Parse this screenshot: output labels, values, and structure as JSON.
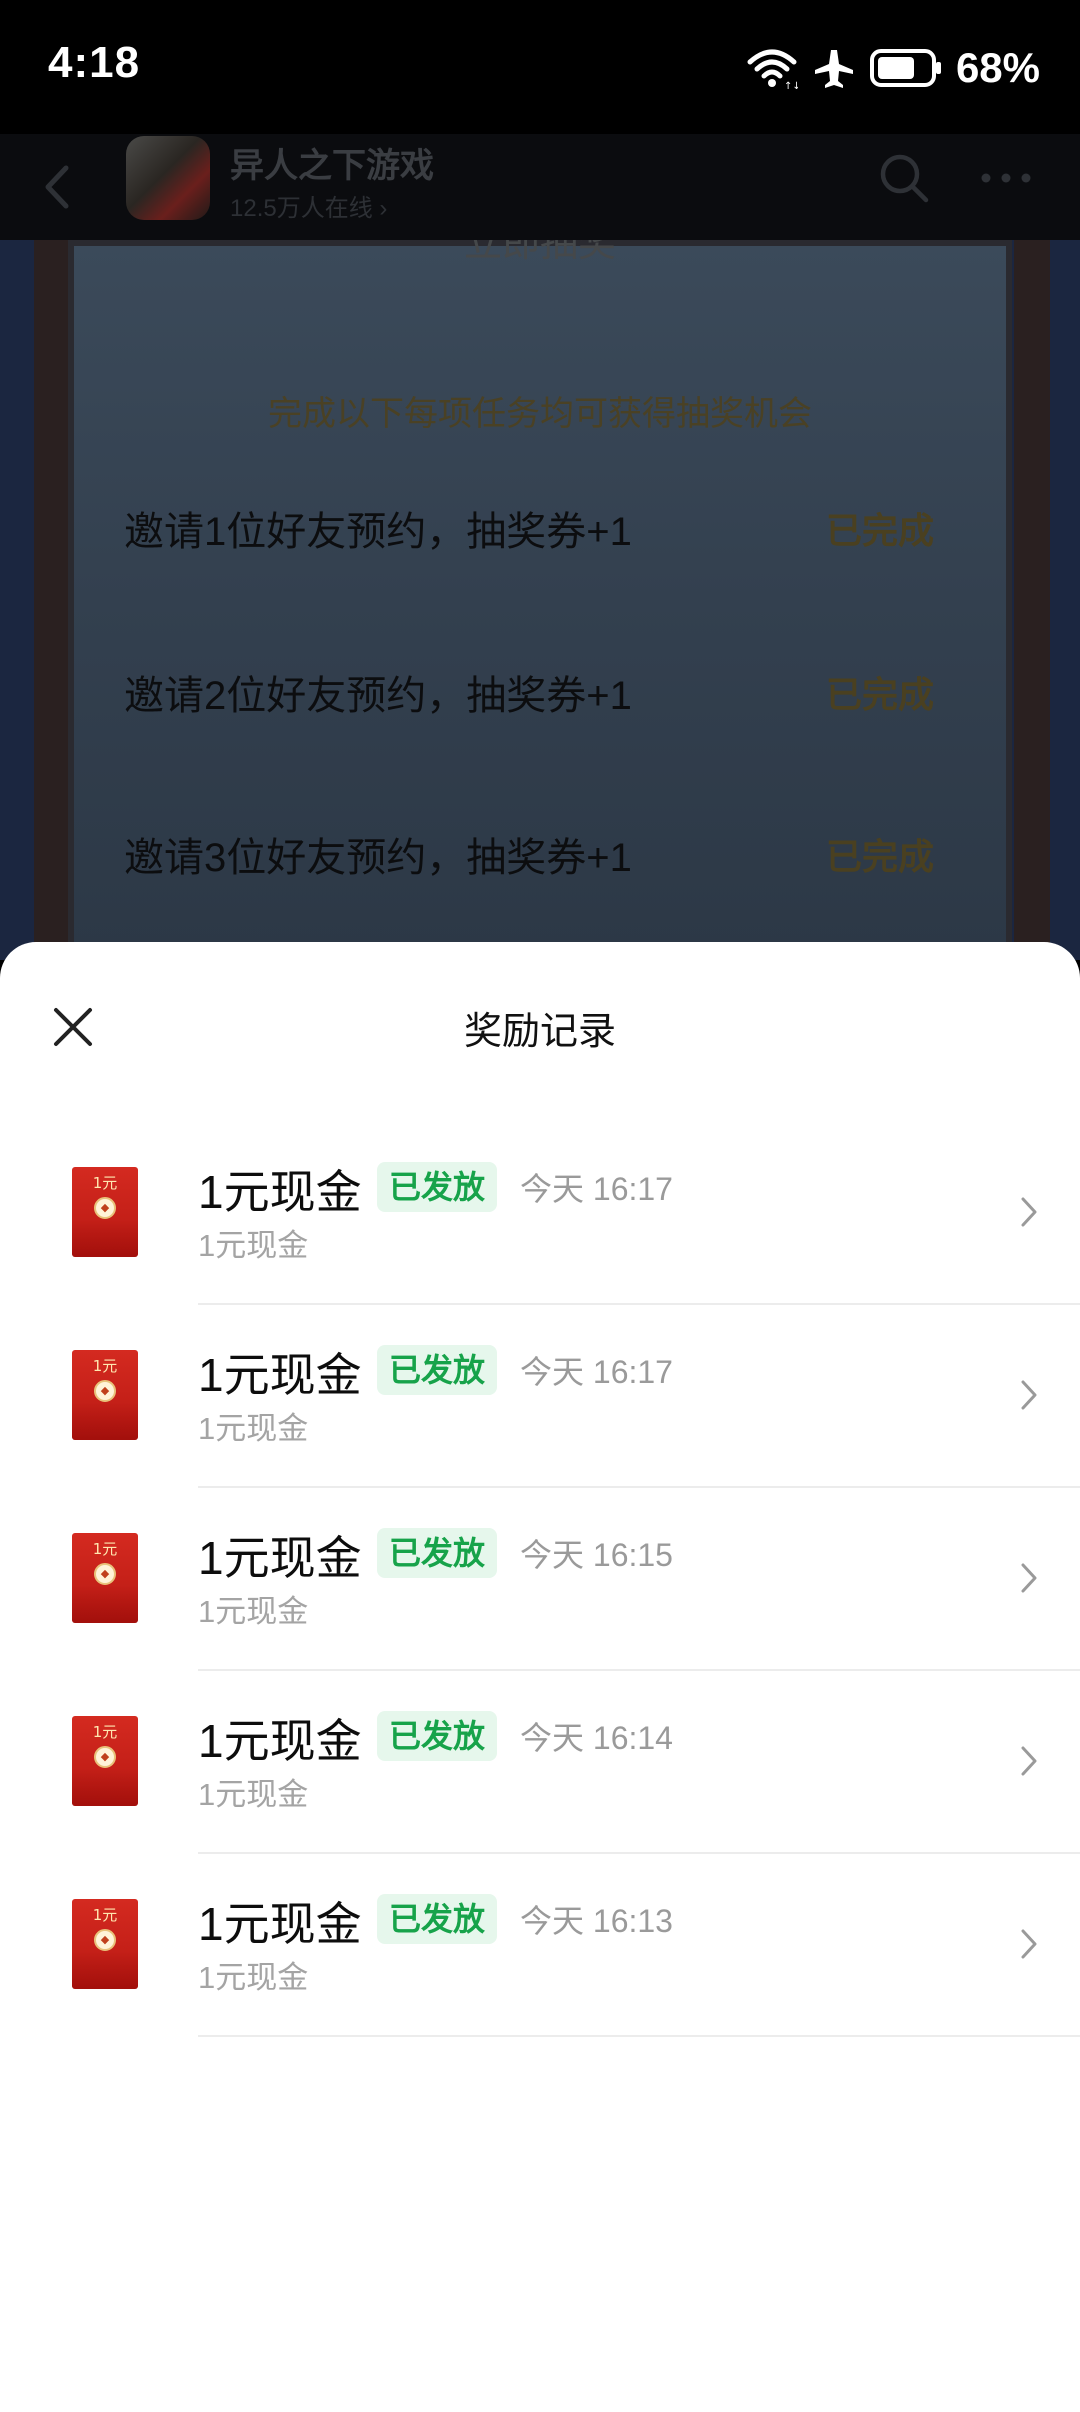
{
  "status_bar": {
    "time": "4:18",
    "battery_percent": "68%",
    "icons": [
      "wifi-icon",
      "airplane-icon",
      "battery-icon"
    ]
  },
  "header": {
    "title": "异人之下游戏",
    "online": "12.5万人在线"
  },
  "background_page": {
    "draw_title": "立即抽奖",
    "task_hint": "完成以下每项任务均可获得抽奖机会",
    "tasks": [
      {
        "label": "邀请1位好友预约，抽奖券+1",
        "status": "已完成"
      },
      {
        "label": "邀请2位好友预约，抽奖券+1",
        "status": "已完成"
      },
      {
        "label": "邀请3位好友预约，抽奖券+1",
        "status": "已完成"
      }
    ]
  },
  "sheet": {
    "title": "奖励记录",
    "records": [
      {
        "name": "1元现金",
        "badge": "已发放",
        "time": "今天 16:17",
        "sub": "1元现金",
        "packet_label": "1元"
      },
      {
        "name": "1元现金",
        "badge": "已发放",
        "time": "今天 16:17",
        "sub": "1元现金",
        "packet_label": "1元"
      },
      {
        "name": "1元现金",
        "badge": "已发放",
        "time": "今天 16:15",
        "sub": "1元现金",
        "packet_label": "1元"
      },
      {
        "name": "1元现金",
        "badge": "已发放",
        "time": "今天 16:14",
        "sub": "1元现金",
        "packet_label": "1元"
      },
      {
        "name": "1元现金",
        "badge": "已发放",
        "time": "今天 16:13",
        "sub": "1元现金",
        "packet_label": "1元"
      }
    ]
  },
  "colors": {
    "badge_text": "#17a34a",
    "badge_bg": "#e6f7ec",
    "redpacket": "#c81e16"
  }
}
